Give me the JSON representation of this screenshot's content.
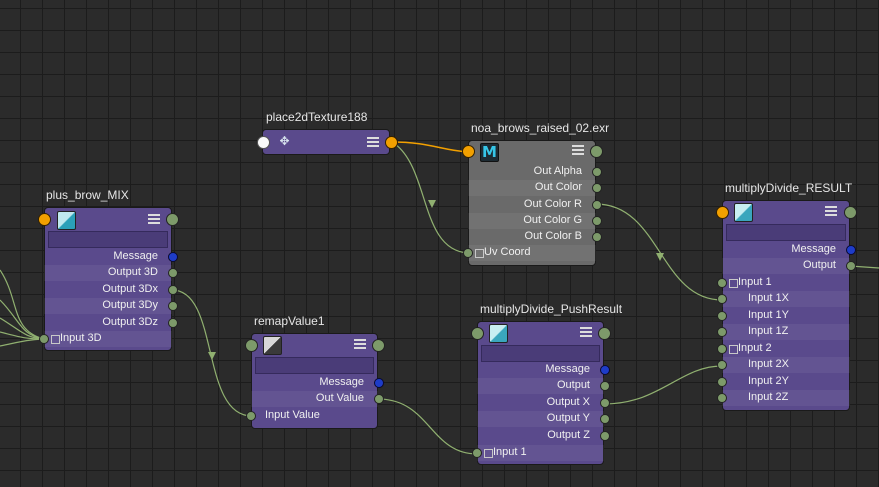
{
  "nodes": {
    "place2d": {
      "title": "place2dTexture188"
    },
    "file": {
      "title": "noa_brows_raised_02.exr",
      "icon_letter": "M",
      "attrs": [
        "Out Alpha",
        "Out Color",
        "Out Color R",
        "Out Color G",
        "Out Color B",
        "Uv Coord"
      ]
    },
    "plus": {
      "title": "plus_brow_MIX",
      "attrs": [
        "Message",
        "Output 3D",
        "Output 3Dx",
        "Output 3Dy",
        "Output 3Dz",
        "Input 3D"
      ]
    },
    "remap": {
      "title": "remapValue1",
      "attrs": [
        "Message",
        "Out Value",
        "Input Value"
      ]
    },
    "push": {
      "title": "multiplyDivide_PushResult",
      "attrs": [
        "Message",
        "Output",
        "Output X",
        "Output Y",
        "Output Z",
        "Input 1"
      ]
    },
    "result": {
      "title": "multiplyDivide_RESULT",
      "attrs": [
        "Message",
        "Output",
        "Input 1",
        "Input 1X",
        "Input 1Y",
        "Input 1Z",
        "Input 2",
        "Input 2X",
        "Input 2Y",
        "Input 2Z"
      ]
    }
  },
  "colors": {
    "canvas": "#2b2b2b",
    "node_purple": "#5a4a8c",
    "node_gray": "#6a6a6a",
    "connection_orange": "#f2a000",
    "connection_green": "#90b070",
    "message_plug": "#1e3cc8"
  }
}
